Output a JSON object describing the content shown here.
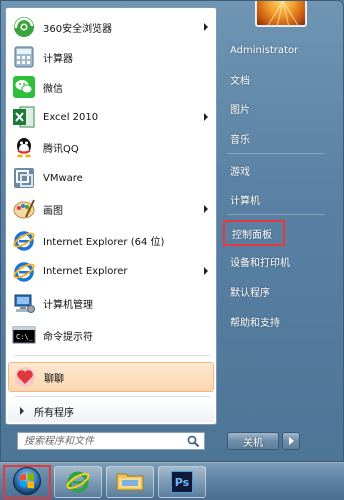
{
  "left_menu": {
    "items": [
      {
        "label": "360安全浏览器",
        "icon": "360-browser-icon",
        "has_arrow": true
      },
      {
        "label": "计算器",
        "icon": "calculator-icon",
        "has_arrow": false
      },
      {
        "label": "微信",
        "icon": "wechat-icon",
        "has_arrow": false
      },
      {
        "label": "Excel 2010",
        "icon": "excel-icon",
        "has_arrow": true
      },
      {
        "label": "腾讯QQ",
        "icon": "qq-icon",
        "has_arrow": false
      },
      {
        "label": "VMware",
        "icon": "vmware-icon",
        "has_arrow": false
      },
      {
        "label": "画图",
        "icon": "paint-icon",
        "has_arrow": true
      },
      {
        "label": "Internet Explorer (64 位)",
        "icon": "ie-icon",
        "has_arrow": false
      },
      {
        "label": "Internet Explorer",
        "icon": "ie-icon",
        "has_arrow": true
      },
      {
        "label": "计算机管理",
        "icon": "computer-management-icon",
        "has_arrow": false
      },
      {
        "label": "命令提示符",
        "icon": "cmd-icon",
        "has_arrow": false
      },
      {
        "label": "聊聊",
        "icon": "chat-heart-icon",
        "has_arrow": false,
        "highlighted": true
      }
    ],
    "all_programs_label": "所有程序",
    "search_placeholder": "搜索程序和文件"
  },
  "right_menu": {
    "items": [
      {
        "label": "Administrator"
      },
      {
        "label": "文档"
      },
      {
        "label": "图片"
      },
      {
        "label": "音乐"
      },
      {
        "label": "游戏"
      },
      {
        "label": "计算机"
      },
      {
        "label": "控制面板",
        "highlighted_box": true
      },
      {
        "label": "设备和打印机"
      },
      {
        "label": "默认程序"
      },
      {
        "label": "帮助和支持"
      }
    ],
    "shutdown_label": "关机"
  },
  "taskbar": {
    "items": [
      {
        "name": "start-button",
        "icon": "windows-orb-icon"
      },
      {
        "name": "ie-taskbar-button",
        "icon": "ie-icon"
      },
      {
        "name": "explorer-taskbar-button",
        "icon": "folder-icon"
      },
      {
        "name": "photoshop-taskbar-button",
        "icon": "photoshop-icon",
        "text": "Ps"
      }
    ]
  },
  "colors": {
    "highlight_box": "#e53a3a",
    "hover_item": "#fbd7b0",
    "menu_blue": "#5b82a4"
  }
}
